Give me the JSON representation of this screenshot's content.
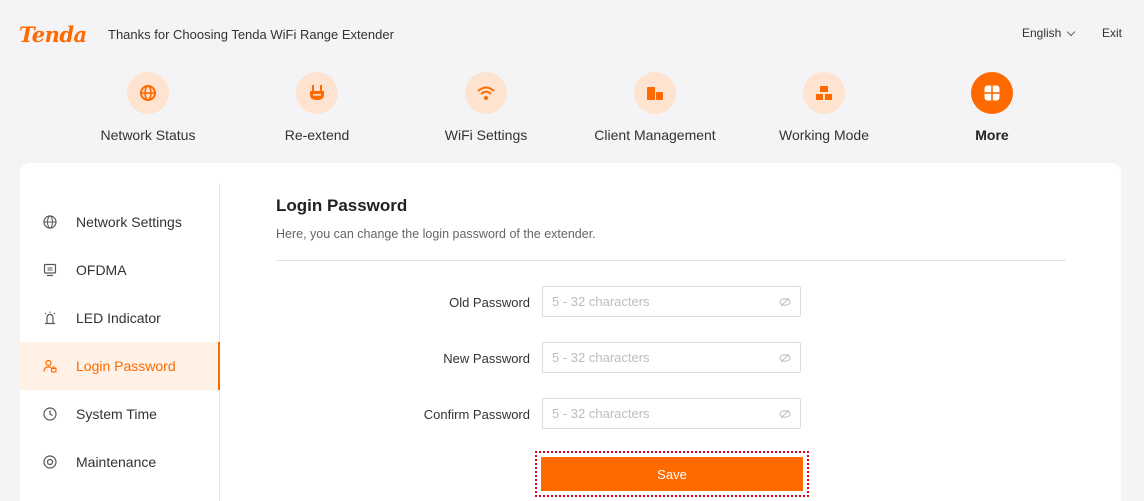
{
  "header": {
    "brand": "Tenda",
    "welcome": "Thanks for Choosing Tenda WiFi Range Extender",
    "language": "English",
    "exit": "Exit"
  },
  "nav": [
    {
      "label": "Network Status",
      "icon": "globe-icon"
    },
    {
      "label": "Re-extend",
      "icon": "extender-plug-icon"
    },
    {
      "label": "WiFi Settings",
      "icon": "wifi-icon"
    },
    {
      "label": "Client Management",
      "icon": "devices-icon"
    },
    {
      "label": "Working Mode",
      "icon": "mode-icon"
    },
    {
      "label": "More",
      "icon": "grid-icon",
      "active": true
    }
  ],
  "sidebar": [
    {
      "label": "Network Settings",
      "icon": "globe-icon"
    },
    {
      "label": "OFDMA",
      "icon": "monitor-icon"
    },
    {
      "label": "LED Indicator",
      "icon": "led-icon"
    },
    {
      "label": "Login Password",
      "icon": "user-lock-icon",
      "active": true
    },
    {
      "label": "System Time",
      "icon": "clock-icon"
    },
    {
      "label": "Maintenance",
      "icon": "maintenance-icon"
    }
  ],
  "content": {
    "title": "Login Password",
    "subtitle": "Here, you can change the login password of the extender.",
    "fields": [
      {
        "label": "Old Password",
        "placeholder": "5 - 32 characters",
        "value": ""
      },
      {
        "label": "New Password",
        "placeholder": "5 - 32 characters",
        "value": ""
      },
      {
        "label": "Confirm Password",
        "placeholder": "5 - 32 characters",
        "value": ""
      }
    ],
    "save_label": "Save"
  },
  "colors": {
    "accent": "#ff6a00",
    "accent_light": "#fde3d0",
    "highlight_outline": "#e0001a"
  }
}
